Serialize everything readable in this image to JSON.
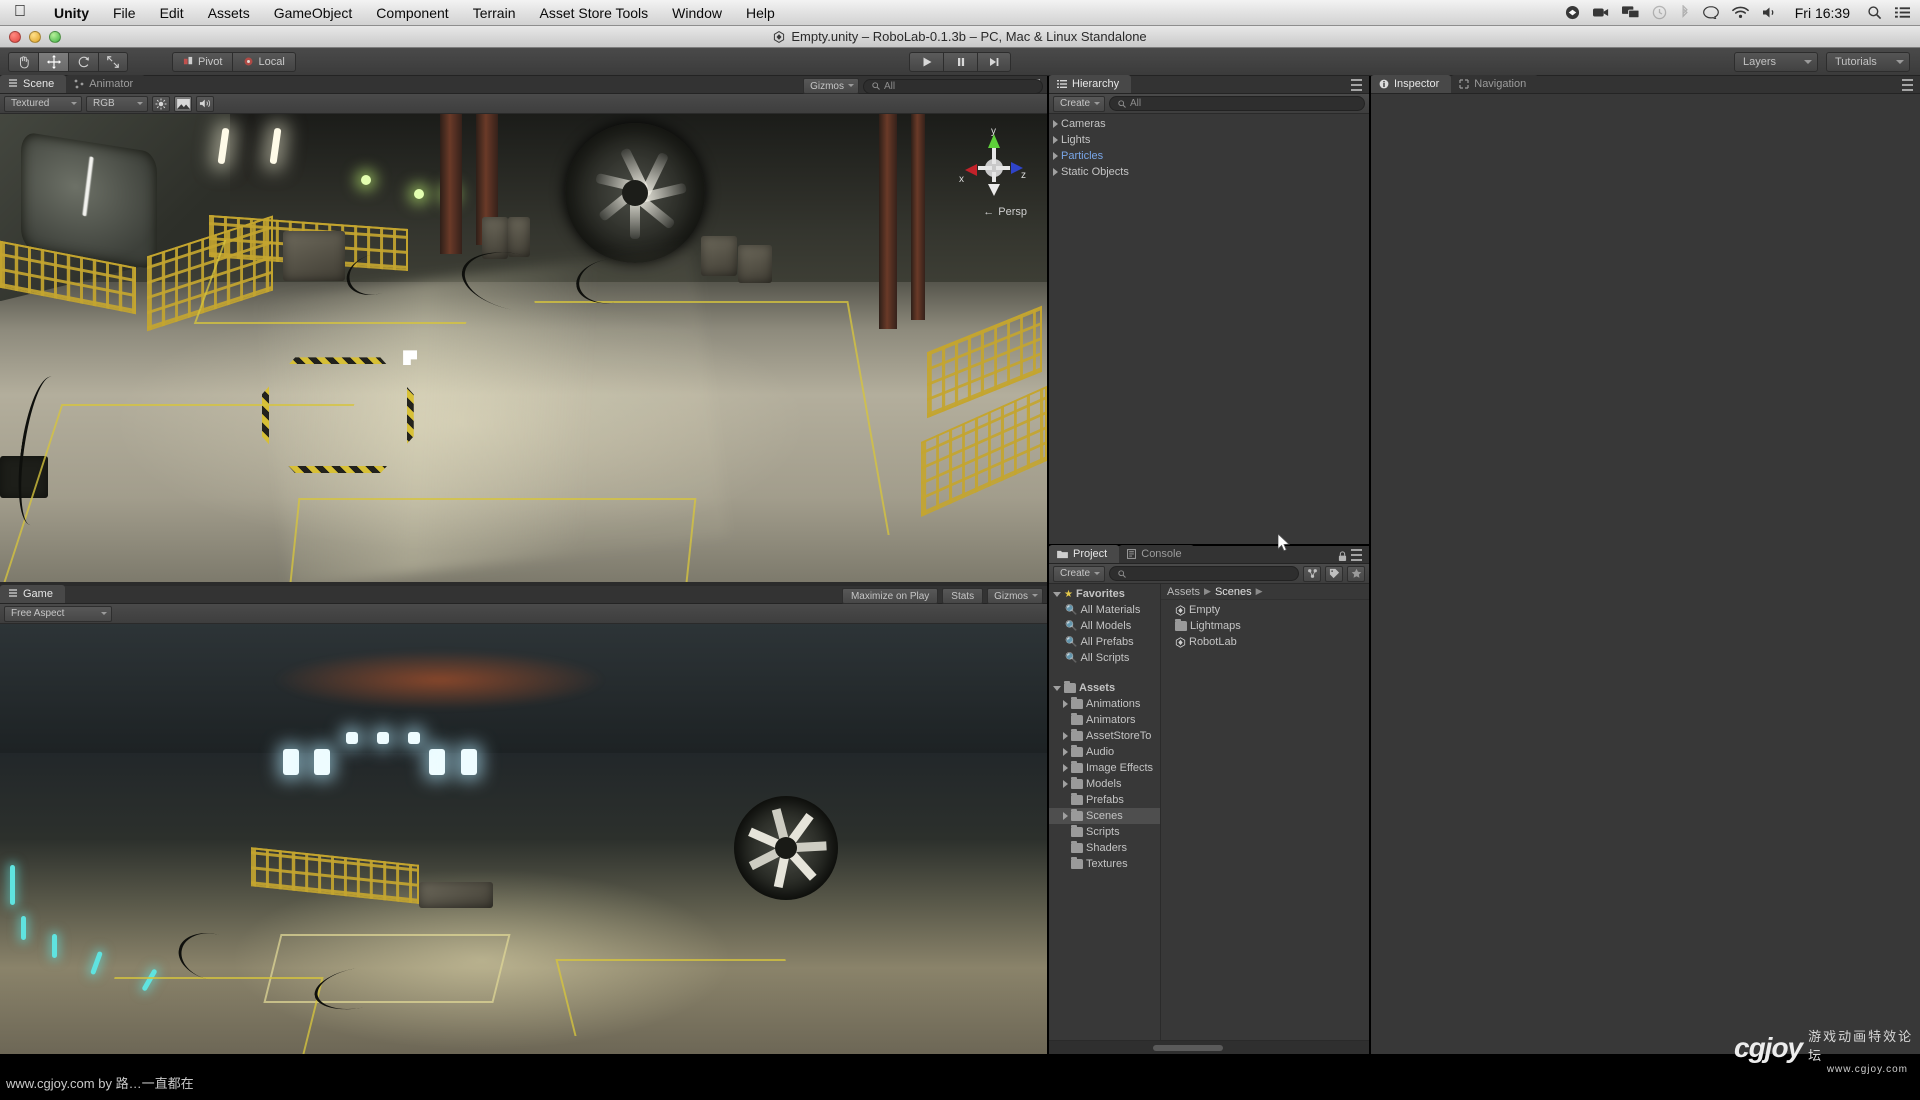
{
  "macbar": {
    "apple_icon": "apple-logo",
    "menus": [
      "Unity",
      "File",
      "Edit",
      "Assets",
      "GameObject",
      "Component",
      "Terrain",
      "Asset Store Tools",
      "Window",
      "Help"
    ],
    "status_icons": [
      "dropbox-icon",
      "screen-record-icon",
      "display-mirror-icon",
      "time-machine-icon",
      "bluetooth-icon",
      "messages-icon",
      "wifi-icon",
      "volume-icon"
    ],
    "clock": "Fri 16:39",
    "spotlight_icon": "search-icon",
    "notification_icon": "notification-center-icon"
  },
  "window": {
    "title": "Empty.unity – RoboLab-0.1.3b – PC, Mac & Linux Standalone",
    "app_icon": "unity-logo-icon"
  },
  "toolbar": {
    "transform_tools": [
      {
        "name": "hand-tool",
        "glyph": "✋",
        "active": false
      },
      {
        "name": "move-tool",
        "glyph": "✛",
        "active": true
      },
      {
        "name": "rotate-tool",
        "glyph": "⟳",
        "active": false
      },
      {
        "name": "scale-tool",
        "glyph": "⤢",
        "active": false
      }
    ],
    "pivot_label": "Pivot",
    "local_label": "Local",
    "play_controls": [
      {
        "name": "play-button",
        "glyph": "▶"
      },
      {
        "name": "pause-button",
        "glyph": "❚❚"
      },
      {
        "name": "step-button",
        "glyph": "▶❙"
      }
    ],
    "layers_label": "Layers",
    "tutorials_label": "Tutorials"
  },
  "scene": {
    "tabs": [
      {
        "label": "Scene",
        "icon": "scene-icon",
        "active": true
      },
      {
        "label": "Animator",
        "icon": "animator-icon",
        "active": false
      }
    ],
    "draw_mode": "Textured",
    "color_mode": "RGB",
    "toggles": [
      {
        "name": "lighting-toggle",
        "glyph": "☀",
        "active": false
      },
      {
        "name": "skybox-toggle",
        "glyph": "🖼",
        "active": true
      },
      {
        "name": "audio-toggle",
        "glyph": "🔊",
        "active": false
      }
    ],
    "gizmos_label": "Gizmos",
    "search_placeholder": "All",
    "axis": {
      "x": "x",
      "y": "y",
      "z": "z"
    },
    "projection": "Persp"
  },
  "game": {
    "tabs": [
      {
        "label": "Game",
        "icon": "game-icon",
        "active": true
      }
    ],
    "aspect": "Free Aspect",
    "maximize_label": "Maximize on Play",
    "stats_label": "Stats",
    "gizmos_label": "Gizmos"
  },
  "hierarchy": {
    "tab_label": "Hierarchy",
    "tab_icon": "hierarchy-icon",
    "create_label": "Create",
    "search_placeholder": "All",
    "items": [
      {
        "label": "Cameras",
        "expandable": true,
        "selected": false
      },
      {
        "label": "Lights",
        "expandable": true,
        "selected": false
      },
      {
        "label": "Particles",
        "expandable": true,
        "selected": true
      },
      {
        "label": "Static Objects",
        "expandable": true,
        "selected": false
      }
    ]
  },
  "inspector": {
    "tabs": [
      {
        "label": "Inspector",
        "icon": "info-icon",
        "active": true
      },
      {
        "label": "Navigation",
        "icon": "navigation-icon",
        "active": false
      }
    ]
  },
  "project": {
    "tabs": [
      {
        "label": "Project",
        "icon": "folder-icon",
        "active": true
      },
      {
        "label": "Console",
        "icon": "console-icon",
        "active": false
      }
    ],
    "create_label": "Create",
    "search_placeholder": "",
    "lock_icon": "lock-icon",
    "toolbar_icons": [
      "filter-by-type-icon",
      "filter-by-label-icon",
      "favorite-star-icon"
    ],
    "favorites": {
      "label": "Favorites",
      "items": [
        "All Materials",
        "All Models",
        "All Prefabs",
        "All Scripts"
      ]
    },
    "assets": {
      "label": "Assets",
      "items": [
        {
          "label": "Animations",
          "expandable": true,
          "selected": false
        },
        {
          "label": "Animators",
          "expandable": false,
          "selected": false
        },
        {
          "label": "AssetStoreTo",
          "expandable": true,
          "selected": false
        },
        {
          "label": "Audio",
          "expandable": true,
          "selected": false
        },
        {
          "label": "Image Effects",
          "expandable": true,
          "selected": false
        },
        {
          "label": "Models",
          "expandable": true,
          "selected": false
        },
        {
          "label": "Prefabs",
          "expandable": false,
          "selected": false
        },
        {
          "label": "Scenes",
          "expandable": true,
          "selected": true
        },
        {
          "label": "Scripts",
          "expandable": false,
          "selected": false
        },
        {
          "label": "Shaders",
          "expandable": false,
          "selected": false
        },
        {
          "label": "Textures",
          "expandable": false,
          "selected": false
        }
      ]
    },
    "breadcrumb": [
      "Assets",
      "Scenes"
    ],
    "contents": [
      {
        "label": "Empty",
        "type": "scene"
      },
      {
        "label": "Lightmaps",
        "type": "folder"
      },
      {
        "label": "RobotLab",
        "type": "scene"
      }
    ]
  },
  "watermark": {
    "bottom_left": "www.cgjoy.com by 路…一直都在",
    "logo_text": "cgjoy",
    "logo_cn": "游戏动画特效论坛",
    "logo_url": "www.cgjoy.com"
  },
  "colors": {
    "accent_blue": "#79a6e8",
    "panel_bg": "#383838",
    "toolbar_bg": "#3b3b3b",
    "selection": "#4e4e4e",
    "star_yellow": "#e3c84a"
  }
}
